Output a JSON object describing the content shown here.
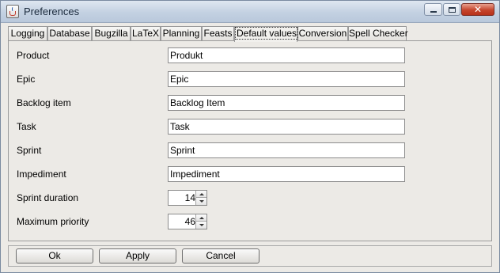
{
  "window": {
    "title": "Preferences",
    "controls": {
      "minimize": "minimize",
      "maximize": "maximize",
      "close": "✕"
    }
  },
  "tabs": [
    {
      "label": "Logging"
    },
    {
      "label": "Database"
    },
    {
      "label": "Bugzilla"
    },
    {
      "label": "LaTeX"
    },
    {
      "label": "Planning"
    },
    {
      "label": "Feasts"
    },
    {
      "label": "Default values",
      "active": true
    },
    {
      "label": "Conversion"
    },
    {
      "label": "Spell Checker"
    }
  ],
  "fields": [
    {
      "label": "Product",
      "value": "Produkt"
    },
    {
      "label": "Epic",
      "value": "Epic"
    },
    {
      "label": "Backlog item",
      "value": "Backlog Item"
    },
    {
      "label": "Task",
      "value": "Task"
    },
    {
      "label": "Sprint",
      "value": "Sprint"
    },
    {
      "label": "Impediment",
      "value": "Impediment"
    }
  ],
  "spinners": [
    {
      "label": "Sprint duration",
      "value": "14"
    },
    {
      "label": "Maximum priority",
      "value": "46"
    }
  ],
  "buttons": {
    "ok": "Ok",
    "apply": "Apply",
    "cancel": "Cancel"
  }
}
